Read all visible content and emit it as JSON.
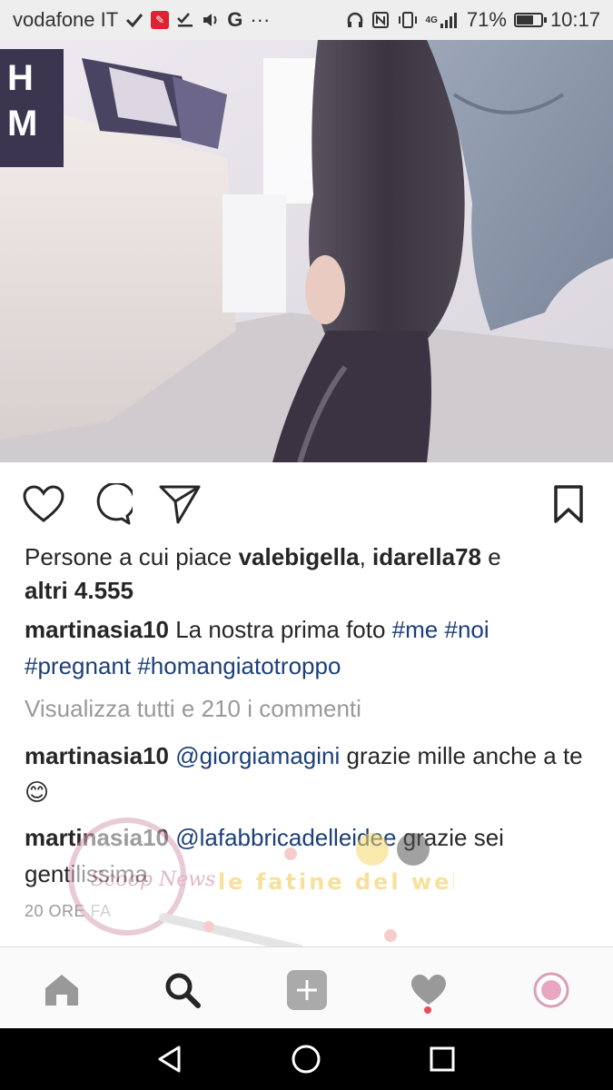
{
  "status_bar": {
    "carrier": "vodafone IT",
    "network": "4G",
    "battery_percent": "71%",
    "battery_level": 0.71,
    "time": "10:17"
  },
  "post": {
    "likes_prefix": "Persone a cui piace ",
    "liker1": "valebigella",
    "sep": ", ",
    "liker2": "idarella78",
    "and": " e",
    "others": "altri 4.555",
    "caption_user": "martinasia10",
    "caption_text": " La nostra prima foto ",
    "hashtags": [
      "#me",
      "#noi",
      "#pregnant",
      "#homangiatotroppo"
    ],
    "view_all": "Visualizza tutti e 210 i commenti",
    "comments": [
      {
        "user": "martinasia10",
        "mention": "@giorgiamagini",
        "text": " grazie mille anche a te 😊"
      },
      {
        "user": "martinasia10",
        "mention": "@lafabbricadelleidee",
        "text": " grazie sei gentilissima"
      }
    ],
    "time_ago": "20 ORE FA"
  },
  "watermark": {
    "logo_text": "Scoop News",
    "brand_text": "le fatine del web"
  },
  "icons": {
    "like": "heart-icon",
    "comment": "comment-icon",
    "share": "send-icon",
    "save": "bookmark-icon",
    "home": "home-icon",
    "search": "search-icon",
    "add": "add-icon",
    "activity": "heart-icon",
    "profile": "profile-avatar"
  }
}
